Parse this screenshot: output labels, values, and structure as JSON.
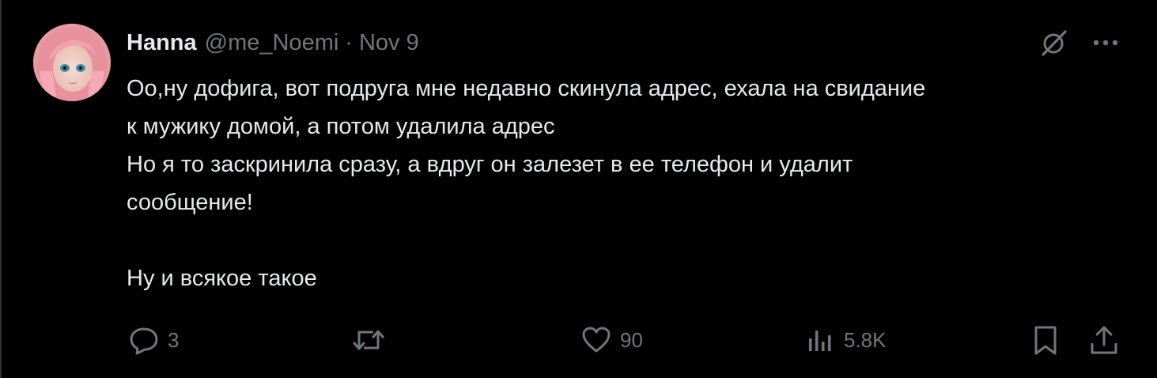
{
  "author": {
    "display_name": "Hanna",
    "handle": "@me_Noemi",
    "separator": "·",
    "date": "Nov 9"
  },
  "tweet": {
    "lines": [
      "Оо,ну дофига, вот подруга мне недавно скинула адрес, ехала на свидание",
      "к мужику домой, а потом удалила адрес",
      "Но я то заскринила сразу, а вдруг он залезет в ее телефон и удалит",
      "сообщение!",
      "Ну и всякое такое"
    ]
  },
  "actions": {
    "replies": "3",
    "reposts": "",
    "likes": "90",
    "views": "5.8K"
  },
  "icons": {
    "grok": "grok-slash-icon",
    "more": "more-dots-icon",
    "reply": "reply-bubble-icon",
    "repost": "repost-arrows-icon",
    "like": "heart-icon",
    "views": "bar-chart-icon",
    "bookmark": "bookmark-icon",
    "share": "share-upload-icon"
  },
  "colors": {
    "background": "#000000",
    "text_primary": "#e7e9ea",
    "text_secondary": "#71767b"
  }
}
